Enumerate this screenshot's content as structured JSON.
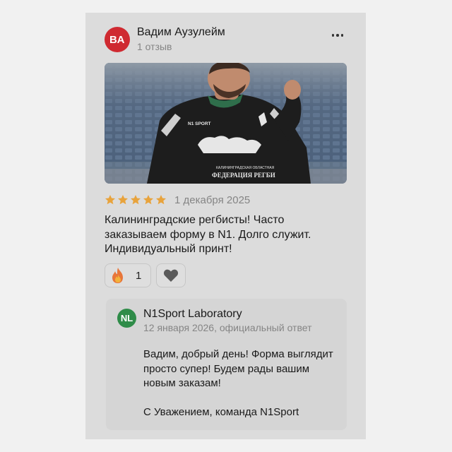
{
  "review": {
    "author": {
      "initials": "ВА",
      "name": "Вадим Аузулейм",
      "reviews_count": "1 отзыв"
    },
    "more_icon": "ellipsis-icon",
    "photo": {
      "shirt_brand": "N1 SPORT",
      "shirt_text_top": "КАЛИНИНГРАДСКАЯ ОБЛАСТНАЯ",
      "shirt_text": "ФЕДЕРАЦИЯ РЕГБИ"
    },
    "rating": 5,
    "rating_max": 5,
    "date": "1 декабря 2025",
    "text": "Калининградские регбисты! Часто заказываем форму в N1. Долго служит. Индивидуальный принт!",
    "reactions": {
      "fire_icon": "fire-icon",
      "fire_count": "1",
      "like_icon": "heart-icon"
    }
  },
  "answer": {
    "initials": "NL",
    "name": "N1Sport Laboratory",
    "meta": "12 января 2026, официальный ответ",
    "text": "Вадим, добрый день! Форма выглядит просто супер! Будем рады вашим новым заказам!\n\nС Уважением, команда N1Sport"
  },
  "colors": {
    "author_avatar": "#cf2a31",
    "answer_avatar": "#2f8c49",
    "star": "#e8a33c",
    "overlay_bg": "#dcdcdc"
  }
}
